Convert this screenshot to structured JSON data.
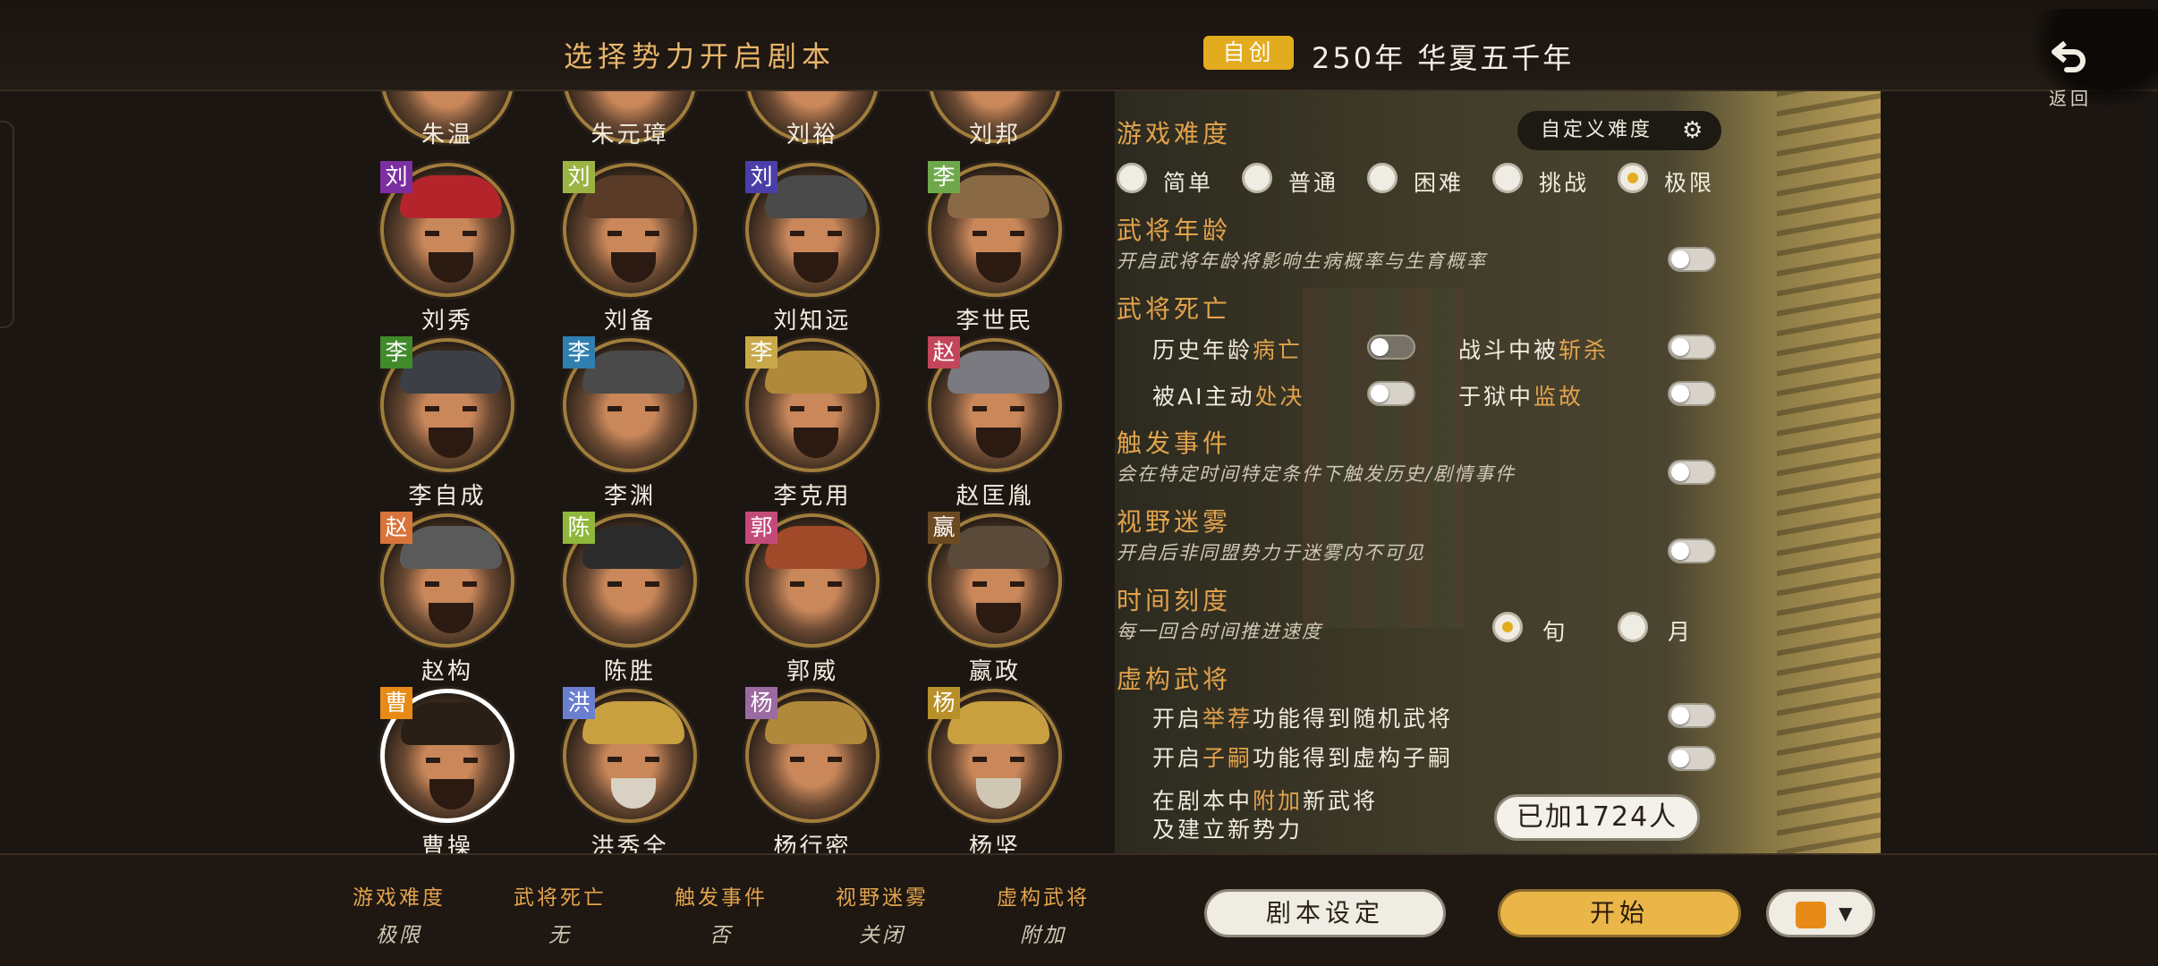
{
  "header": {
    "title": "选择势力开启剧本",
    "badge": "自创",
    "year": "250年 华夏五千年",
    "back_label": "返回"
  },
  "characters": [
    {
      "name": "朱温",
      "surname": "",
      "color": "#000000"
    },
    {
      "name": "朱元璋",
      "surname": "",
      "color": "#000000"
    },
    {
      "name": "刘裕",
      "surname": "",
      "color": "#000000"
    },
    {
      "name": "刘邦",
      "surname": "",
      "color": "#000000"
    },
    {
      "name": "刘秀",
      "surname": "刘",
      "color": "#7b2fa0"
    },
    {
      "name": "刘备",
      "surname": "刘",
      "color": "#9bb343"
    },
    {
      "name": "刘知远",
      "surname": "刘",
      "color": "#4a3fa8"
    },
    {
      "name": "李世民",
      "surname": "李",
      "color": "#6fa84a"
    },
    {
      "name": "李自成",
      "surname": "李",
      "color": "#3f8a2a"
    },
    {
      "name": "李渊",
      "surname": "李",
      "color": "#2f7fb0"
    },
    {
      "name": "李克用",
      "surname": "李",
      "color": "#c9a84a"
    },
    {
      "name": "赵匡胤",
      "surname": "赵",
      "color": "#c2455a"
    },
    {
      "name": "赵构",
      "surname": "赵",
      "color": "#d8743a"
    },
    {
      "name": "陈胜",
      "surname": "陈",
      "color": "#8fb83a"
    },
    {
      "name": "郭威",
      "surname": "郭",
      "color": "#c44a7a"
    },
    {
      "name": "嬴政",
      "surname": "嬴",
      "color": "#6b4a22"
    },
    {
      "name": "曹操",
      "surname": "曹",
      "color": "#e88a18"
    },
    {
      "name": "洪秀全",
      "surname": "洪",
      "color": "#6a7fd0"
    },
    {
      "name": "杨行密",
      "surname": "杨",
      "color": "#9a6aa0"
    },
    {
      "name": "杨坚",
      "surname": "杨",
      "color": "#b8902a"
    }
  ],
  "settings": {
    "difficulty": {
      "title": "游戏难度",
      "custom_label": "自定义难度",
      "options": [
        "简单",
        "普通",
        "困难",
        "挑战",
        "极限"
      ],
      "selected": "极限"
    },
    "age": {
      "title": "武将年龄",
      "desc": "开启武将年龄将影响生病概率与生育概率"
    },
    "death": {
      "title": "武将死亡",
      "opt1_a": "历史年龄",
      "opt1_b": "病亡",
      "opt2_a": "战斗中被",
      "opt2_b": "斩杀",
      "opt3_a": "被AI主动",
      "opt3_b": "处决",
      "opt4_a": "于狱中",
      "opt4_b": "监故"
    },
    "events": {
      "title": "触发事件",
      "desc": "会在特定时间特定条件下触发历史/剧情事件"
    },
    "fog": {
      "title": "视野迷雾",
      "desc": "开启后非同盟势力于迷雾内不可见"
    },
    "time": {
      "title": "时间刻度",
      "desc": "每一回合时间推进速度",
      "options": [
        "旬",
        "月"
      ],
      "selected": "旬"
    },
    "fictional": {
      "title": "虚构武将",
      "opt1_a": "开启",
      "opt1_b": "举荐",
      "opt1_c": "功能得到随机武将",
      "opt2_a": "开启",
      "opt2_b": "子嗣",
      "opt2_c": "功能得到虚构子嗣",
      "add_a": "在剧本中",
      "add_b": "附加",
      "add_c": "新武将",
      "add_d": "及建立新势力",
      "added_label": "已加1724人"
    }
  },
  "summary": [
    {
      "key": "游戏难度",
      "value": "极限"
    },
    {
      "key": "武将死亡",
      "value": "无"
    },
    {
      "key": "触发事件",
      "value": "否"
    },
    {
      "key": "视野迷雾",
      "value": "关闭"
    },
    {
      "key": "虚构武将",
      "value": "附加"
    }
  ],
  "buttons": {
    "script_settings": "剧本设定",
    "start": "开始",
    "color_swatch": "#e88a18"
  },
  "icons": {
    "back": "undo-arrow-icon",
    "gear": "gear-icon",
    "dropdown": "caret-down-icon"
  }
}
